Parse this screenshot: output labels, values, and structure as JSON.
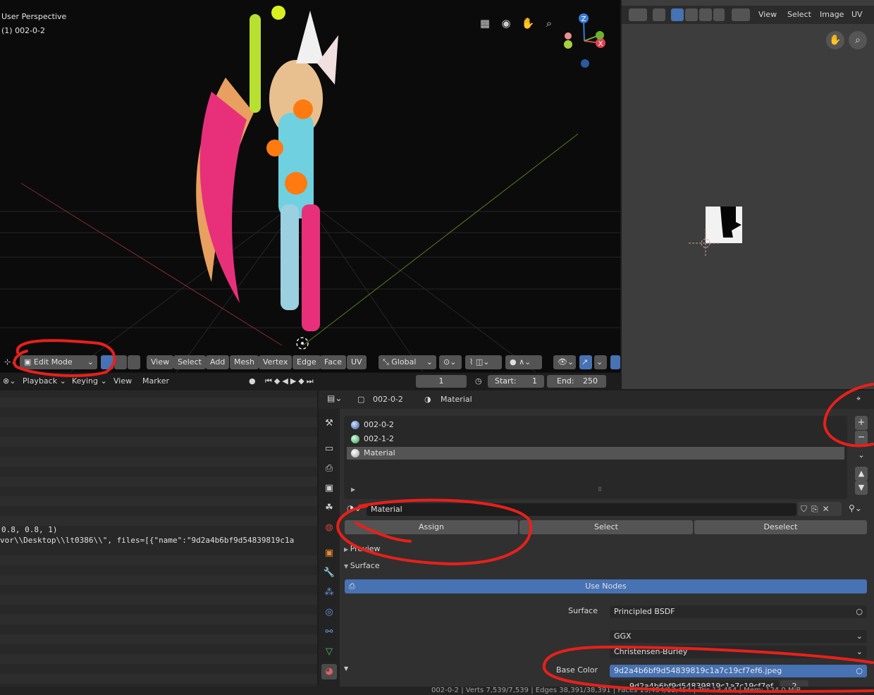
{
  "viewport": {
    "title": "User Perspective",
    "object": "(1) 002-0-2",
    "header": {
      "mode": "Edit Mode",
      "menus": [
        "View",
        "Select",
        "Add",
        "Mesh",
        "Vertex",
        "Edge",
        "Face",
        "UV"
      ],
      "orientation": "Global"
    }
  },
  "timeline": {
    "menus": [
      "Playback",
      "Keying",
      "View",
      "Marker"
    ],
    "current_frame": "1",
    "start_label": "Start:",
    "start_value": "1",
    "end_label": "End:",
    "end_value": "250"
  },
  "image_editor": {
    "menus": [
      "View",
      "Select",
      "Image",
      "UV"
    ]
  },
  "console": {
    "line1": "0.8, 0.8, 1)",
    "line2": "vor\\\\Desktop\\\\lt0386\\\\\", files=[{\"name\":\"9d2a4b6bf9d54839819c1a"
  },
  "properties": {
    "header": {
      "object": "002-0-2",
      "material": "Material"
    },
    "slots": [
      "002-0-2",
      "002-1-2",
      "Material"
    ],
    "material_name": "Material",
    "buttons": {
      "assign": "Assign",
      "select": "Select",
      "deselect": "Deselect"
    },
    "panels": {
      "preview": "Preview",
      "surface": "Surface"
    },
    "use_nodes": "Use Nodes",
    "surface_label": "Surface",
    "surface_value": "Principled BSDF",
    "distribution": "GGX",
    "subsurface_method": "Christensen-Burley",
    "base_color_label": "Base Color",
    "base_color_value": "9d2a4b6bf9d54839819c1a7c19cf7ef6.jpeg",
    "image_value": "9d2a4b6bf9d54839819c1a7c19cf7ef",
    "image_users": "2"
  },
  "statusbar": {
    "text": "002-0-2 | Verts 7,539/7,539 | Edges 38,391/38,391 | Faces 13,454/13,454 | Tris 13,454 | Mem: 124.0 MiB"
  },
  "colors": {
    "accent": "#4772b3",
    "annotation": "#e8201a",
    "panel": "#303030",
    "viewport_bg": "#0b0b0b"
  }
}
